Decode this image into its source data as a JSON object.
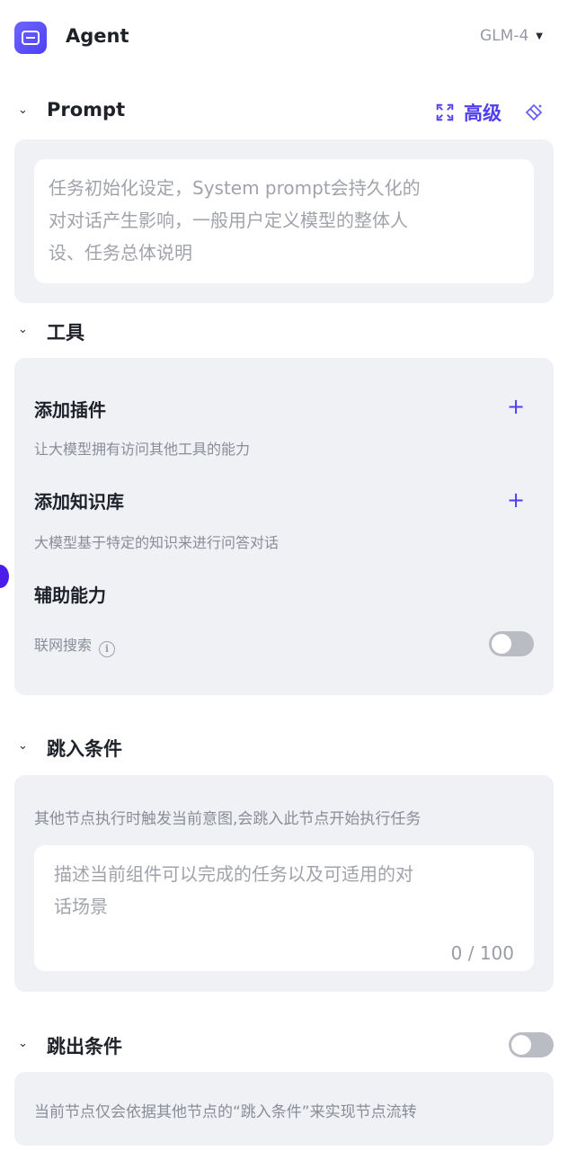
{
  "header": {
    "title": "Agent",
    "model": "GLM-4"
  },
  "prompt": {
    "section_title": "Prompt",
    "advanced_label": "高级",
    "placeholder": "任务初始化设定，System prompt会持久化的\n对对话产生影响，一般用户定义模型的整体人\n设、任务总体说明"
  },
  "tools": {
    "section_title": "工具",
    "plugin": {
      "title": "添加插件",
      "desc": "让大模型拥有访问其他工具的能力"
    },
    "knowledge": {
      "title": "添加知识库",
      "desc": "大模型基于特定的知识来进行问答对话"
    },
    "assist": {
      "title": "辅助能力",
      "web_search_label": "联网搜索",
      "web_search_on": false
    }
  },
  "enter_condition": {
    "section_title": "跳入条件",
    "desc": "其他节点执行时触发当前意图,会跳入此节点开始执行任务",
    "placeholder": "描述当前组件可以完成的任务以及可适用的对\n话场景",
    "counter": "0 / 100"
  },
  "exit_condition": {
    "section_title": "跳出条件",
    "enabled": false,
    "desc": "当前节点仅会依据其他节点的“跳入条件”来实现节点流转"
  },
  "colors": {
    "accent": "#4f3ff0",
    "card_bg": "#f0f1f5",
    "toggle_off": "#b9bcc3"
  }
}
